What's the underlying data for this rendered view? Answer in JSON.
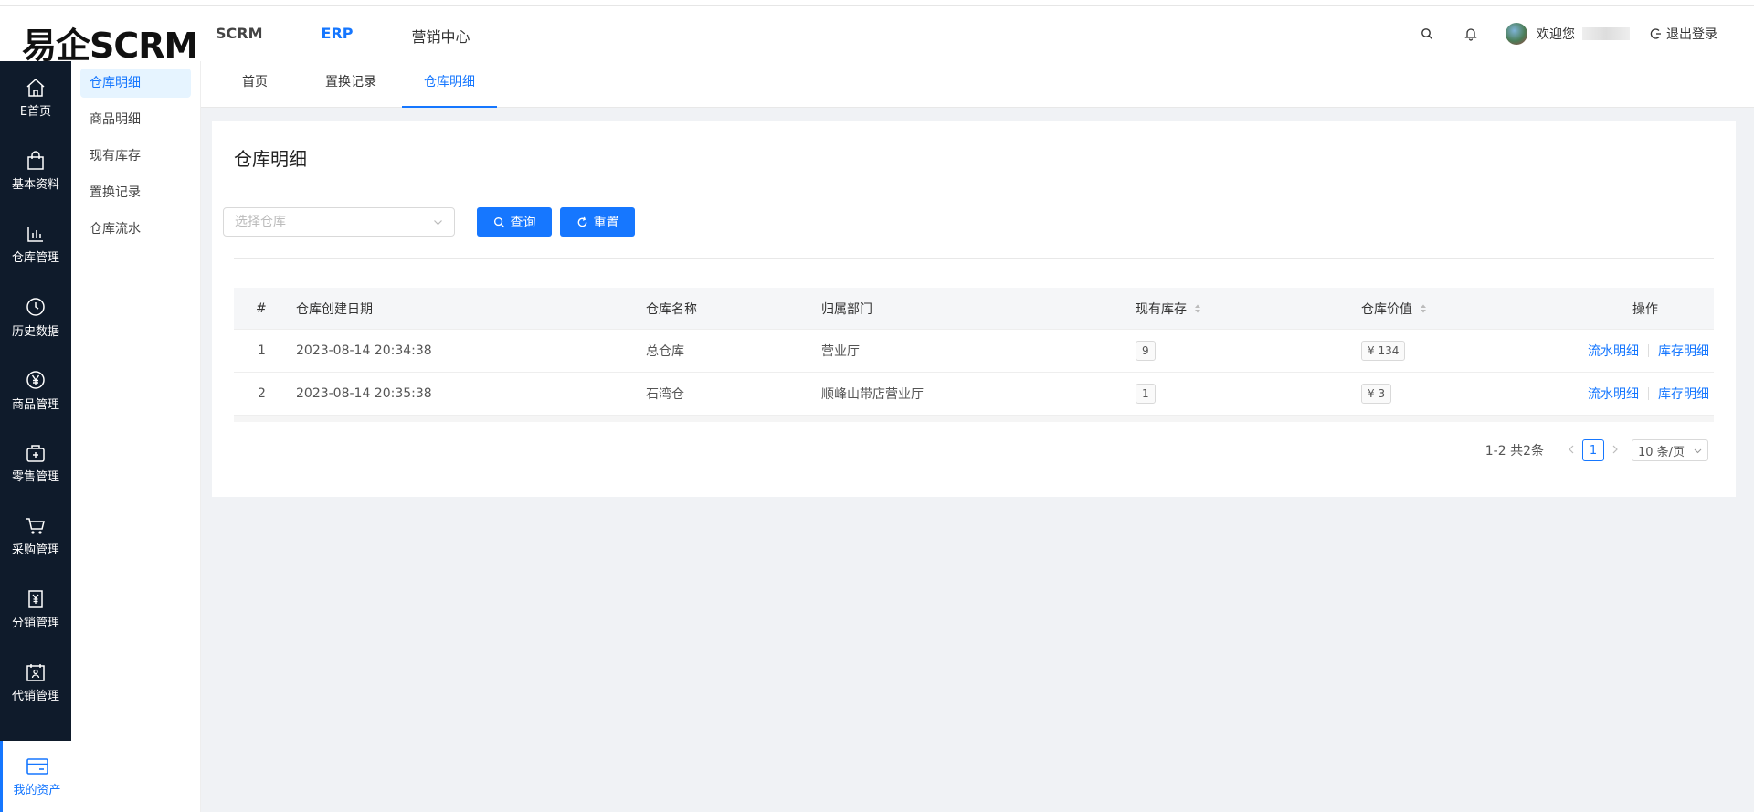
{
  "brand": {
    "logo": "易企SCRM"
  },
  "topnav": [
    {
      "label": "SCRM"
    },
    {
      "label": "ERP"
    },
    {
      "label": "营销中心"
    }
  ],
  "user": {
    "welcome": "欢迎您",
    "logout": "退出登录"
  },
  "sidebar": {
    "items": [
      {
        "label": "E首页",
        "icon": "home-icon"
      },
      {
        "label": "基本资料",
        "icon": "bag-icon"
      },
      {
        "label": "仓库管理",
        "icon": "bar-chart-icon"
      },
      {
        "label": "历史数据",
        "icon": "clock-icon"
      },
      {
        "label": "商品管理",
        "icon": "yen-circle-icon"
      },
      {
        "label": "零售管理",
        "icon": "shop-icon"
      },
      {
        "label": "采购管理",
        "icon": "cart-icon"
      },
      {
        "label": "分销管理",
        "icon": "yen-doc-icon"
      },
      {
        "label": "代销管理",
        "icon": "calendar-person-icon"
      }
    ],
    "active": {
      "label": "我的资产",
      "icon": "card-icon"
    }
  },
  "submenu": [
    {
      "label": "仓库明细"
    },
    {
      "label": "商品明细"
    },
    {
      "label": "现有库存"
    },
    {
      "label": "置换记录"
    },
    {
      "label": "仓库流水"
    }
  ],
  "tabs": [
    {
      "label": "首页"
    },
    {
      "label": "置换记录"
    },
    {
      "label": "仓库明细"
    }
  ],
  "page": {
    "title": "仓库明细",
    "select_placeholder": "选择仓库",
    "query_label": "查询",
    "reset_label": "重置"
  },
  "table": {
    "headers": [
      "#",
      "仓库创建日期",
      "仓库名称",
      "归属部门",
      "现有库存",
      "仓库价值",
      "操作"
    ],
    "rows": [
      {
        "index": "1",
        "date": "2023-08-14 20:34:38",
        "name": "总仓库",
        "dept": "营业厅",
        "stock": "9",
        "value": "¥ 134",
        "action1": "流水明细",
        "action2": "库存明细"
      },
      {
        "index": "2",
        "date": "2023-08-14 20:35:38",
        "name": "石湾仓",
        "dept": "顺峰山带店营业厅",
        "stock": "1",
        "value": "¥ 3",
        "action1": "流水明细",
        "action2": "库存明细"
      }
    ]
  },
  "pagination": {
    "total": "1-2 共2条",
    "current": "1",
    "page_size": "10 条/页"
  },
  "colors": {
    "accent": "#1677ff",
    "sidebar_bg": "#0f1b2b"
  }
}
